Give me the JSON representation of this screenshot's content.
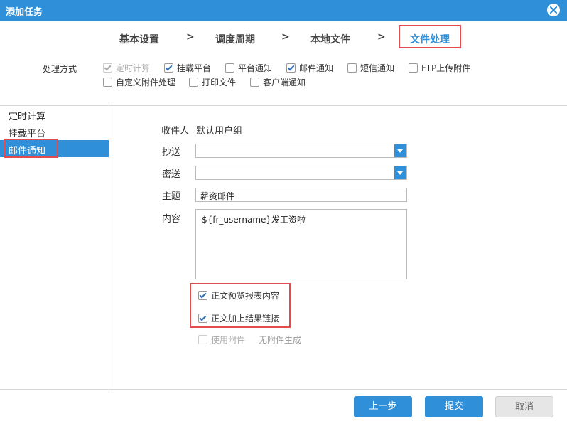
{
  "window": {
    "title": "添加任务"
  },
  "steps": {
    "items": [
      "基本设置",
      "调度周期",
      "本地文件",
      "文件处理"
    ],
    "separator": ">"
  },
  "processing": {
    "label": "处理方式",
    "options": [
      {
        "label": "定时计算",
        "checked": true,
        "disabled": true
      },
      {
        "label": "挂载平台",
        "checked": true,
        "disabled": false
      },
      {
        "label": "平台通知",
        "checked": false,
        "disabled": false
      },
      {
        "label": "邮件通知",
        "checked": true,
        "disabled": false
      },
      {
        "label": "短信通知",
        "checked": false,
        "disabled": false
      },
      {
        "label": "FTP上传附件",
        "checked": false,
        "disabled": false
      },
      {
        "label": "自定义附件处理",
        "checked": false,
        "disabled": false
      },
      {
        "label": "打印文件",
        "checked": false,
        "disabled": false
      },
      {
        "label": "客户端通知",
        "checked": false,
        "disabled": false
      }
    ]
  },
  "sidebar": {
    "items": [
      {
        "label": "定时计算"
      },
      {
        "label": "挂载平台"
      },
      {
        "label": "邮件通知",
        "active": true
      }
    ]
  },
  "form": {
    "recipient_label": "收件人",
    "recipient_value": "默认用户组",
    "cc_label": "抄送",
    "cc_value": "",
    "bcc_label": "密送",
    "bcc_value": "",
    "subject_label": "主题",
    "subject_value": "薪资邮件",
    "content_label": "内容",
    "content_value": "${fr_username}发工资啦",
    "preview_label": "正文预览报表内容",
    "preview_checked": true,
    "link_label": "正文加上结果链接",
    "link_checked": true,
    "attachment_label": "使用附件",
    "attachment_checked": false,
    "no_attachment_label": "无附件生成"
  },
  "buttons": {
    "prev": "上一步",
    "submit": "提交",
    "cancel": "取消"
  },
  "colors": {
    "accent": "#2f8fd8",
    "highlight": "#e24c4c"
  }
}
